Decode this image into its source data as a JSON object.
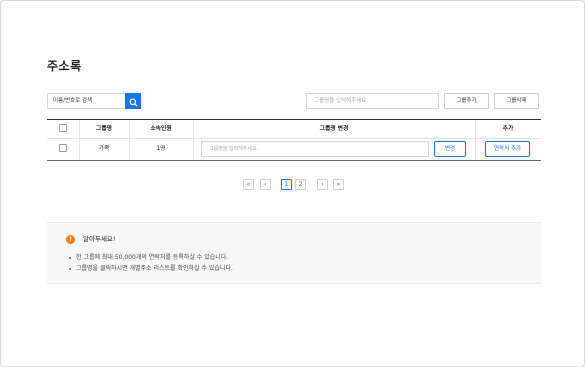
{
  "page": {
    "title": "주소록"
  },
  "search": {
    "value": "이름/번호로 검색"
  },
  "group_input": {
    "placeholder": "그룹명을 입력해주세요."
  },
  "toolbar": {
    "add_group": "그룹추가",
    "delete_group": "그룹삭제"
  },
  "table": {
    "headers": [
      "그룹명",
      "소속인원",
      "그룹명 변경",
      "추가"
    ],
    "rows": [
      {
        "group": "가족",
        "members": "1명",
        "rename_placeholder": "그룹명을 입력해주세요.",
        "rename_button": "변경",
        "add_button": "연락처 추가"
      }
    ]
  },
  "pagination": {
    "first": "«",
    "prev": "‹",
    "pages": [
      "1",
      "2"
    ],
    "active_page": "1",
    "next": "›",
    "last": "»"
  },
  "notice": {
    "title": "알아두세요!",
    "lines": [
      "한 그룹에 최대 50,000개의 연락처를 등록하실 수 있습니다.",
      "그룹명을 클릭하시면 개별주소 리스트를 확인하실 수 있습니다."
    ]
  },
  "colors": {
    "accent": "#1a73e8",
    "notice_icon": "#f07c1a"
  }
}
